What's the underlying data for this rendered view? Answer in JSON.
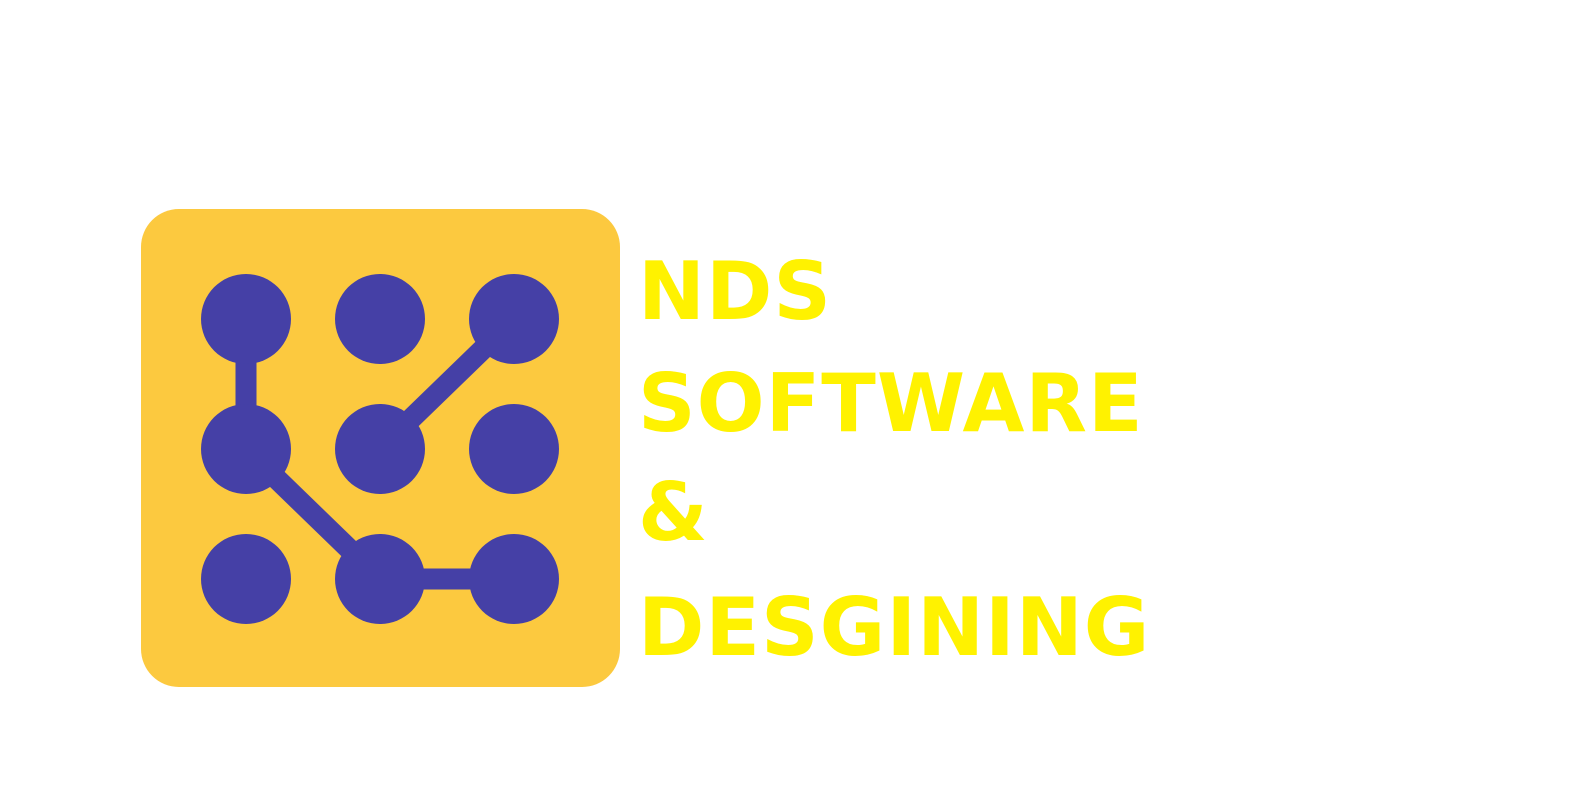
{
  "logo": {
    "mark_icon": "nine-dot-network-icon",
    "background_color": "#fcc93f",
    "dot_color": "#4540a6",
    "text_color": "#fff200",
    "lines": [
      "NDS",
      "SOFTWARE",
      "&",
      "DESGINING"
    ]
  }
}
